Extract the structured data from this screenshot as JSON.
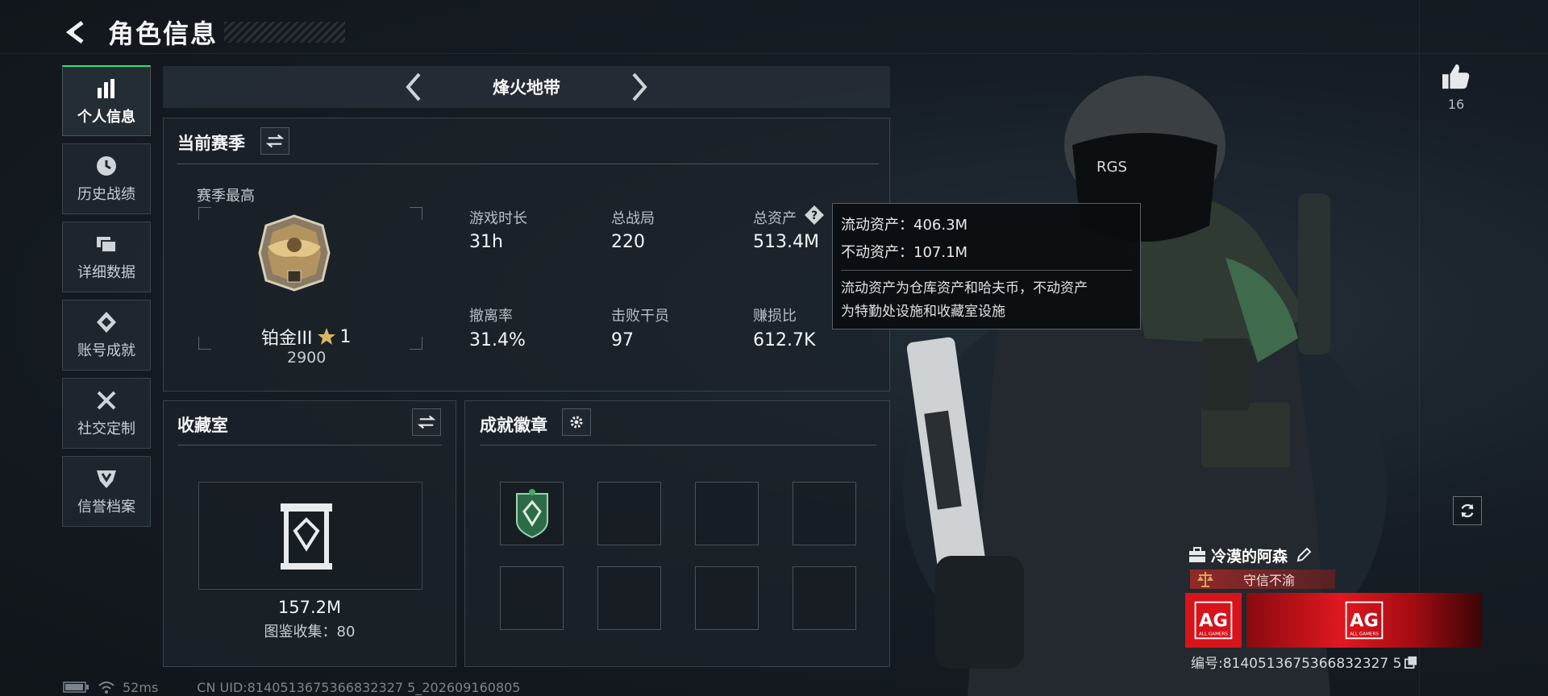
{
  "header": {
    "title": "角色信息"
  },
  "sidebar": {
    "items": [
      {
        "label": "个人信息",
        "icon": "bar-chart-icon",
        "active": true
      },
      {
        "label": "历史战绩",
        "icon": "clock-icon"
      },
      {
        "label": "详细数据",
        "icon": "cards-icon"
      },
      {
        "label": "账号成就",
        "icon": "achievement-icon"
      },
      {
        "label": "社交定制",
        "icon": "tools-icon"
      },
      {
        "label": "信誉档案",
        "icon": "shield-icon"
      }
    ]
  },
  "mode": {
    "title": "烽火地带"
  },
  "season": {
    "title": "当前赛季",
    "best_label": "赛季最高",
    "rank_name": "铂金III",
    "rank_stars": "1",
    "rank_score": "2900",
    "stats": [
      {
        "label": "游戏时长",
        "value": "31h"
      },
      {
        "label": "总战局",
        "value": "220"
      },
      {
        "label": "总资产",
        "value": "513.4M"
      },
      {
        "label": "撤离率",
        "value": "31.4%"
      },
      {
        "label": "击败干员",
        "value": "97"
      },
      {
        "label": "赚损比",
        "value": "612.7K"
      }
    ]
  },
  "tooltip": {
    "liquid": "流动资产：406.3M",
    "fixed": "不动资产：107.1M",
    "desc1": "流动资产为仓库资产和哈夫币，不动资产",
    "desc2": "为特勤处设施和收藏室设施"
  },
  "collection": {
    "title": "收藏室",
    "value": "157.2M",
    "count_text": "图鉴收集：80"
  },
  "badges": {
    "title": "成就徽章"
  },
  "operator_stamp": "RGS",
  "like": {
    "count": "16"
  },
  "player": {
    "name": "冷漠的阿森",
    "credit": "守信不渝",
    "team_logo": "AG",
    "team_sub": "ALL GAMERS",
    "id_text": "编号:8140513675366832327 5"
  },
  "footer": {
    "ping": "52ms",
    "uid": "CN UID:8140513675366832327 5_202609160805"
  },
  "colors": {
    "accent": "#2fe07a",
    "team_red": "#d7141b"
  }
}
